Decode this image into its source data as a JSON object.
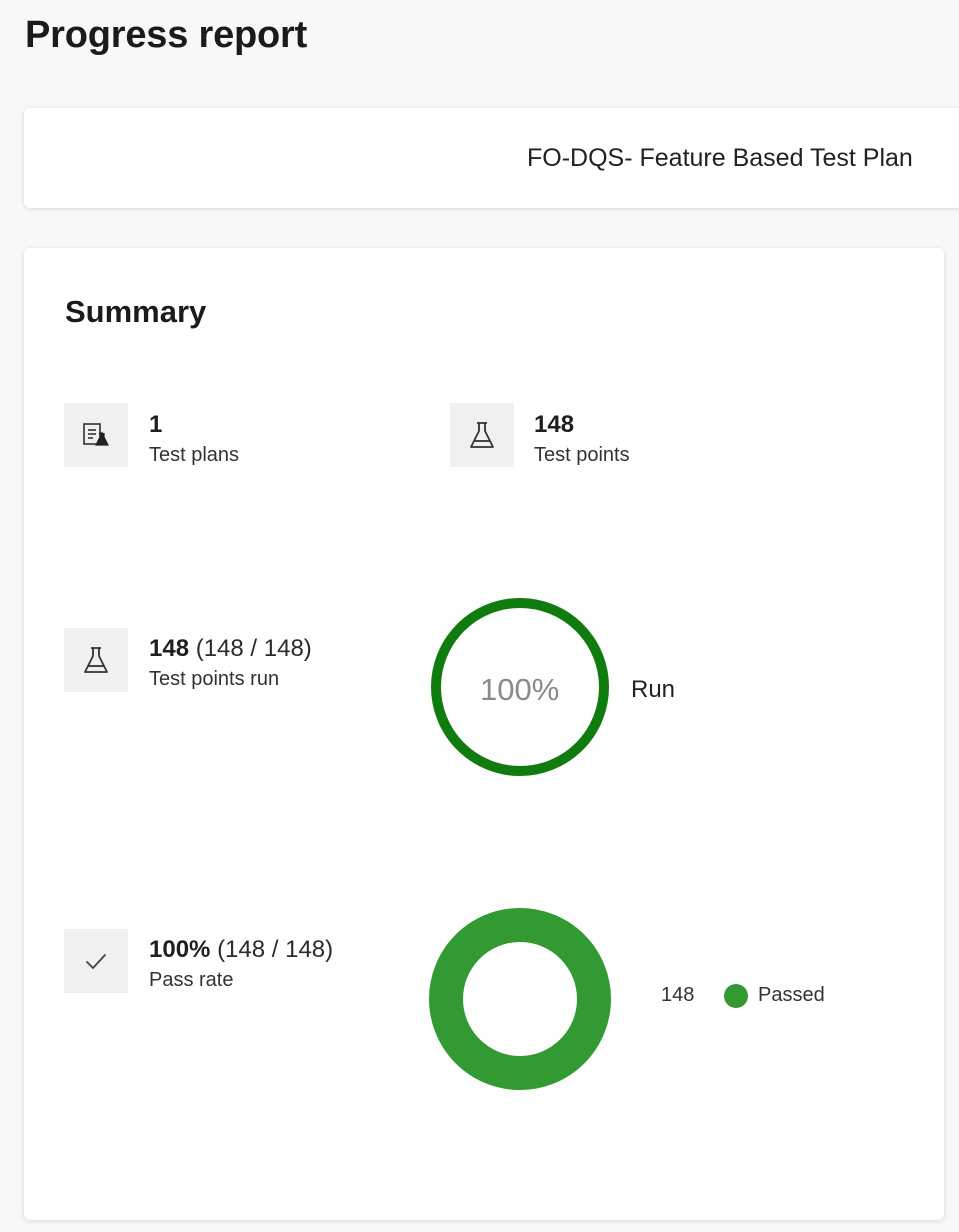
{
  "header": {
    "title": "Progress report"
  },
  "plan": {
    "name": "FO-DQS- Feature Based Test Plan"
  },
  "summary": {
    "title": "Summary",
    "test_plans": {
      "value": "1",
      "label": "Test plans",
      "icon": "test-plan-icon"
    },
    "test_points": {
      "value": "148",
      "label": "Test points",
      "icon": "flask-icon"
    },
    "points_run": {
      "value": "148",
      "detail": "(148 / 148)",
      "label": "Test points run",
      "icon": "flask-icon",
      "ring_text": "100%",
      "ring_caption": "Run",
      "ring_fraction": 1.0,
      "ring_color": "#107c10"
    },
    "pass_rate": {
      "value": "100%",
      "detail": "(148 / 148)",
      "label": "Pass rate",
      "icon": "checkmark-icon",
      "legend": [
        {
          "count": "148",
          "label": "Passed",
          "color": "#339933"
        }
      ]
    }
  }
}
